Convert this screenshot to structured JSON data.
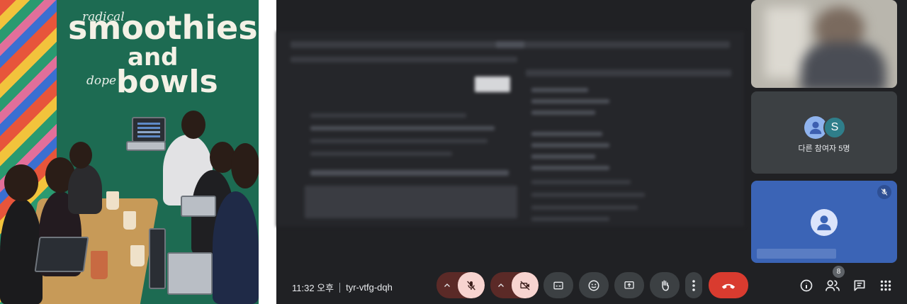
{
  "photo": {
    "wall_text": {
      "radical": "radical",
      "smoothies": "smoothies",
      "and": "and",
      "dope": "dope",
      "bowls": "bowls"
    }
  },
  "meeting": {
    "time": "11:32 오후",
    "code": "tyr-vtfg-dqh",
    "others_label": "다른 참여자 5명",
    "participant_initial": "S",
    "participant_count": "8",
    "colors": {
      "background": "#202124",
      "control": "#3c4043",
      "muted_control": "#f7d4d0",
      "end_call": "#d93b2f",
      "self_tile": "#3b64b6",
      "avatar_teal": "#2f7e8a"
    }
  },
  "controls": {
    "icons": [
      "mic-off-icon",
      "camera-off-icon",
      "captions-icon",
      "emoji-icon",
      "present-icon",
      "raise-hand-icon",
      "more-vert-icon",
      "call-end-icon",
      "info-icon",
      "people-icon",
      "chat-icon",
      "apps-icon"
    ]
  }
}
